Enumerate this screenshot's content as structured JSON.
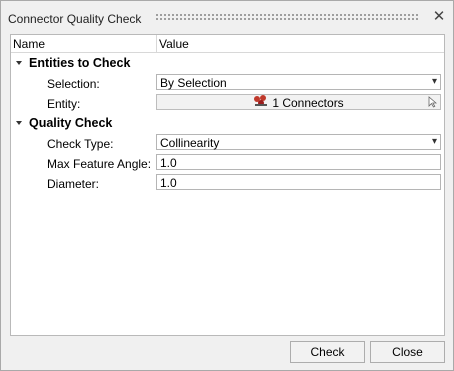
{
  "dialog": {
    "title": "Connector Quality Check"
  },
  "table": {
    "col_name": "Name",
    "col_value": "Value"
  },
  "groups": {
    "entities": {
      "label": "Entities to Check",
      "selection_label": "Selection:",
      "selection_value": "By Selection",
      "entity_label": "Entity:",
      "entity_value": "1 Connectors"
    },
    "quality": {
      "label": "Quality Check",
      "check_type_label": "Check Type:",
      "check_type_value": "Collinearity",
      "max_angle_label": "Max Feature Angle:",
      "max_angle_value": "1.0",
      "diameter_label": "Diameter:",
      "diameter_value": "1.0"
    }
  },
  "buttons": {
    "check": "Check",
    "close": "Close"
  },
  "icons": {
    "close": "close-icon",
    "connector": "connector-icon",
    "dropdown": "chevron-down-icon",
    "cursor": "pointer-cursor-icon"
  },
  "colors": {
    "connector_icon": "#c0392b"
  }
}
